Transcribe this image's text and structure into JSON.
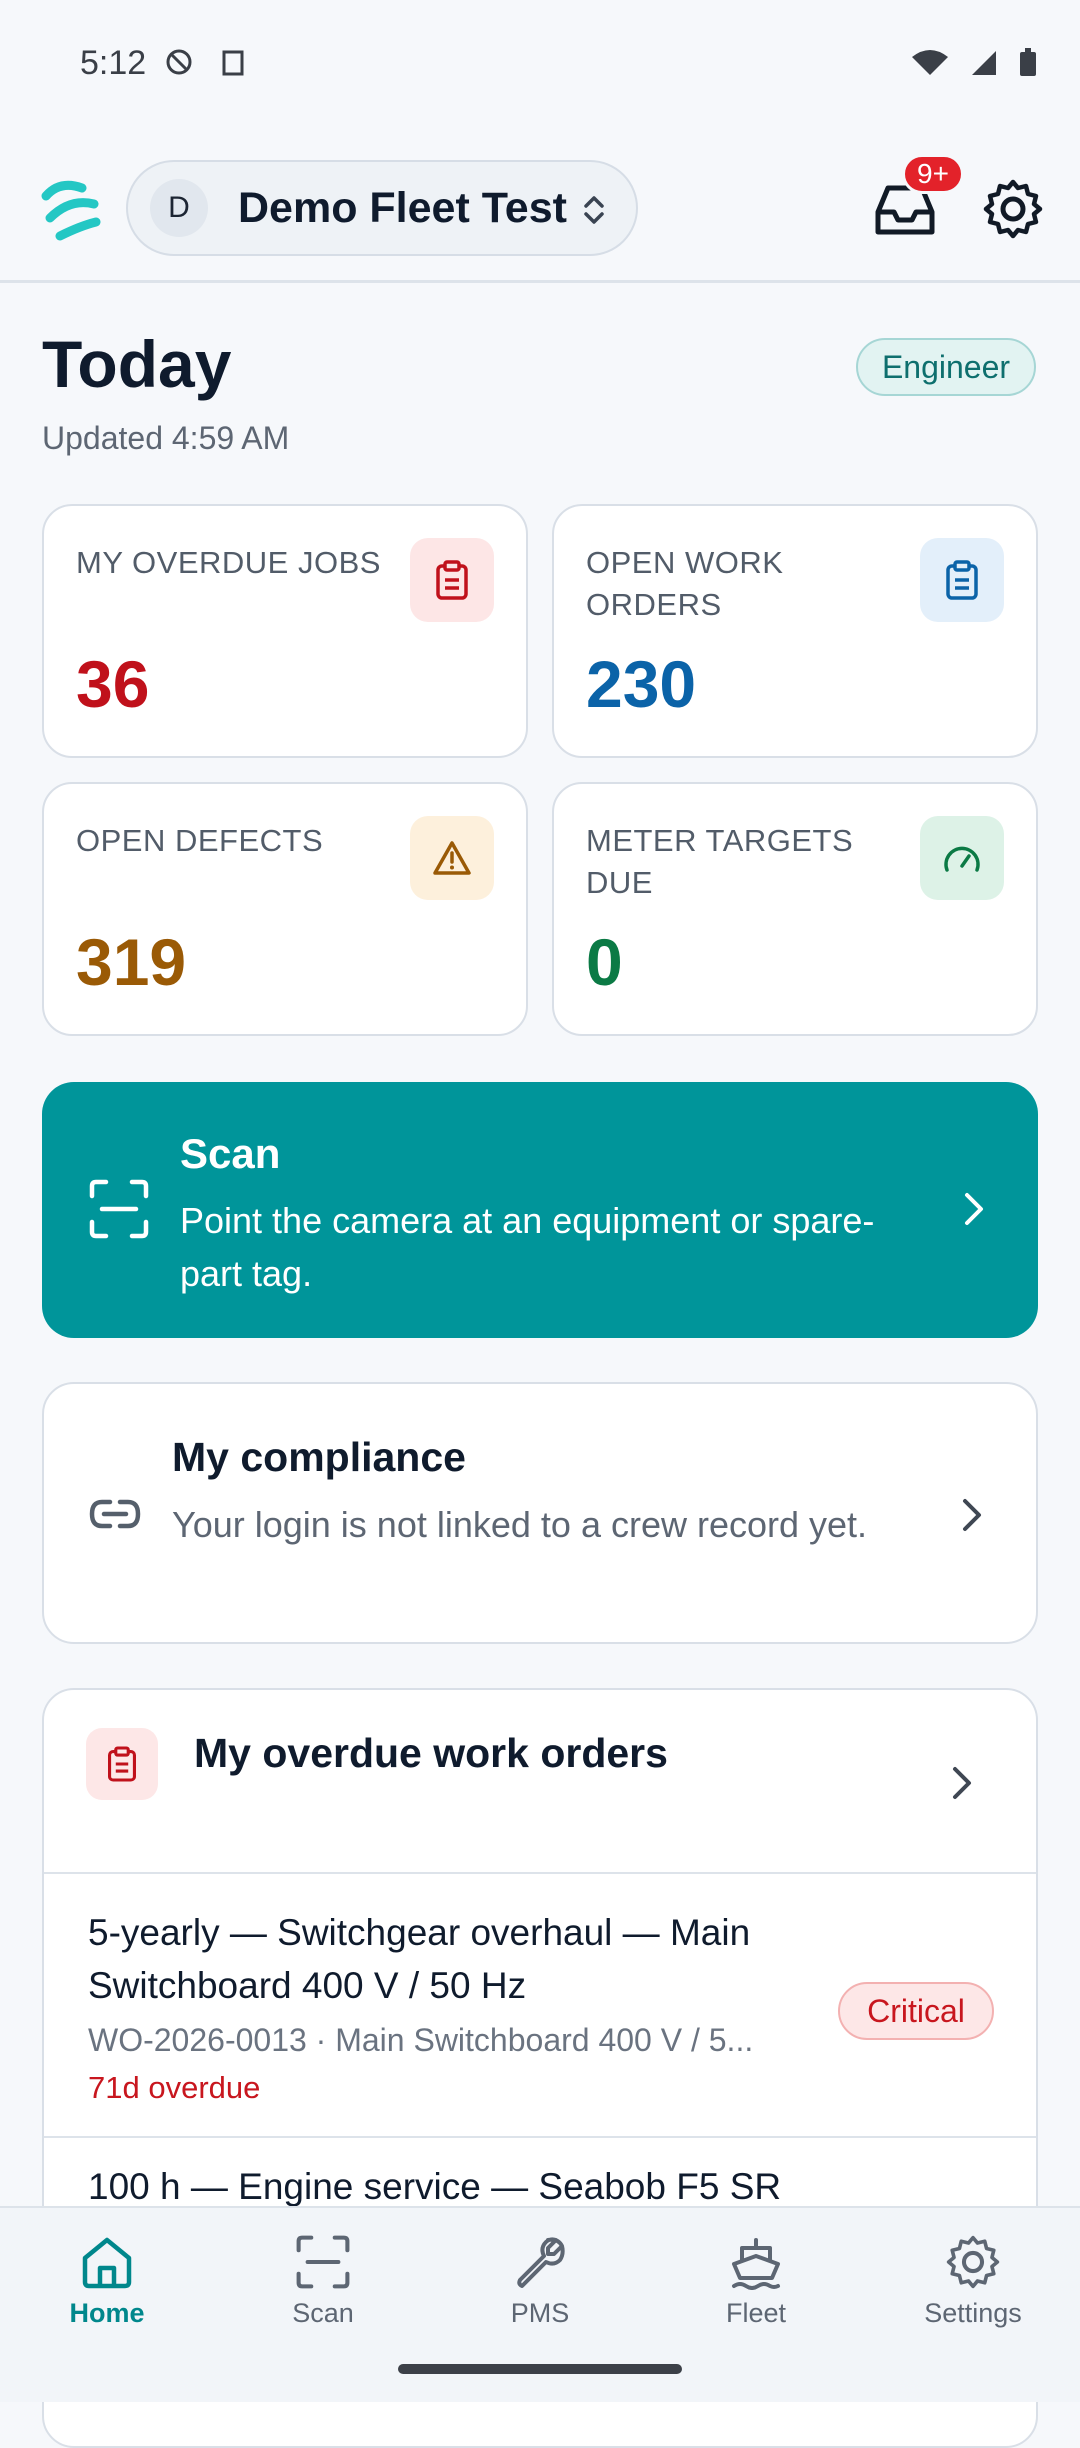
{
  "status_bar": {
    "time": "5:12"
  },
  "header": {
    "fleet_initial": "D",
    "fleet_name": "Demo Fleet Test",
    "notification_badge": "9+"
  },
  "page": {
    "title": "Today",
    "role": "Engineer",
    "updated": "Updated 4:59 AM"
  },
  "stats": [
    {
      "label": "MY OVERDUE JOBS",
      "value": "36",
      "color": "#c0111b",
      "icon": "clipboard-icon"
    },
    {
      "label": "OPEN WORK ORDERS",
      "value": "230",
      "color": "#0b63a8",
      "icon": "clipboard-icon"
    },
    {
      "label": "OPEN DEFECTS",
      "value": "319",
      "color": "#9a5a06",
      "icon": "warning-icon"
    },
    {
      "label": "METER TARGETS DUE",
      "value": "0",
      "color": "#0b7a45",
      "icon": "gauge-icon"
    }
  ],
  "scan_card": {
    "title": "Scan",
    "description": "Point the camera at an equipment or spare-part tag."
  },
  "compliance_card": {
    "title": "My compliance",
    "description": "Your login is not linked to a crew record yet."
  },
  "overdue_card": {
    "title": "My overdue work orders",
    "items": [
      {
        "title": "5-yearly — Switchgear overhaul — Main Switchboard 400 V / 50 Hz",
        "meta": "WO-2026-0013 · Main Switchboard 400 V / 5...",
        "overdue": "71d overdue",
        "priority": "Critical"
      },
      {
        "title": "100 h — Engine service — Seabob F5 SR"
      }
    ]
  },
  "bottom_nav": [
    {
      "label": "Home",
      "icon": "home-icon",
      "active": true
    },
    {
      "label": "Scan",
      "icon": "scan-icon",
      "active": false
    },
    {
      "label": "PMS",
      "icon": "wrench-icon",
      "active": false
    },
    {
      "label": "Fleet",
      "icon": "ship-icon",
      "active": false
    },
    {
      "label": "Settings",
      "icon": "gear-icon",
      "active": false
    }
  ],
  "colors": {
    "accent": "#00959a",
    "critical": "#c8161e"
  }
}
